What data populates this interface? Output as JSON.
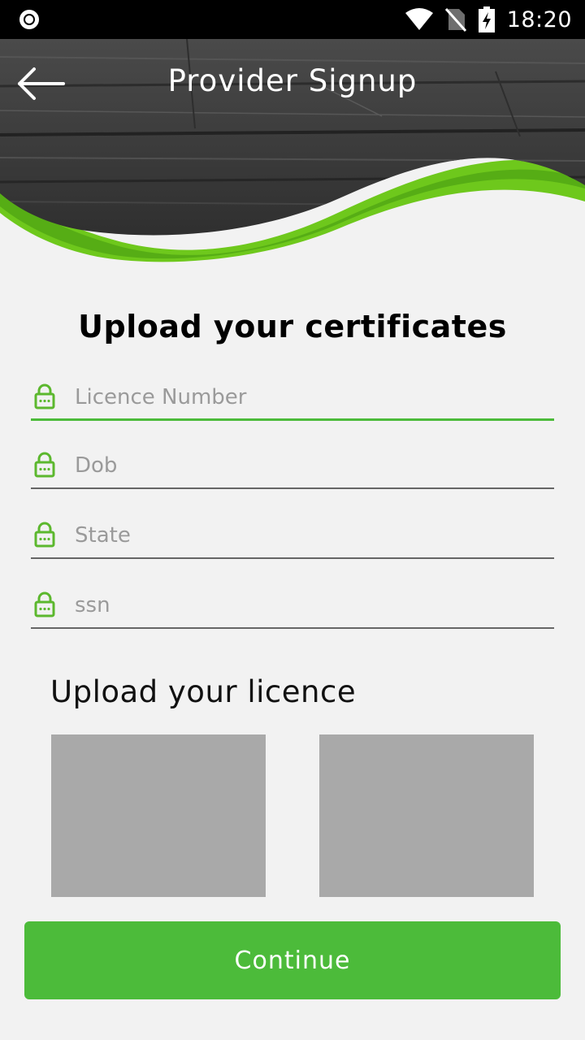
{
  "status_bar": {
    "time": "18:20",
    "icons": [
      "record-icon",
      "wifi-icon",
      "no-sim-icon",
      "battery-charging-icon"
    ]
  },
  "header": {
    "title": "Provider Signup",
    "back_icon": "arrow-left-icon",
    "accent_color": "#5cc21e"
  },
  "form": {
    "heading": "Upload your certificates",
    "fields": [
      {
        "placeholder": "Licence Number",
        "icon": "lock-icon"
      },
      {
        "placeholder": "Dob",
        "icon": "lock-icon"
      },
      {
        "placeholder": "State",
        "icon": "lock-icon"
      },
      {
        "placeholder": "ssn",
        "icon": "lock-icon"
      }
    ]
  },
  "licence": {
    "heading": "Upload your licence"
  },
  "continue_button": {
    "label": "Continue",
    "color": "#4cbb3a"
  }
}
